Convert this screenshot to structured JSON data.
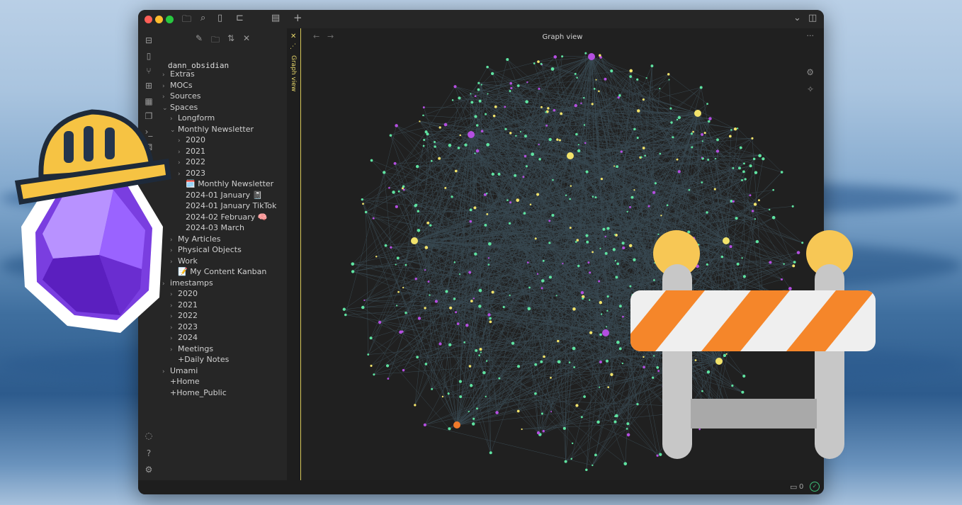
{
  "window": {
    "title": "Graph view",
    "vertical_tab_label": "Graph view",
    "vault_name": "dann_obsidian"
  },
  "tree": [
    {
      "label": "Extras",
      "indent": 0,
      "chev": true
    },
    {
      "label": "MOCs",
      "indent": 0,
      "chev": true
    },
    {
      "label": "Sources",
      "indent": 0,
      "chev": true
    },
    {
      "label": "Spaces",
      "indent": 0,
      "chev": true,
      "open": true
    },
    {
      "label": "Longform",
      "indent": 1,
      "chev": true
    },
    {
      "label": "Monthly Newsletter",
      "indent": 1,
      "chev": true,
      "open": true
    },
    {
      "label": "2020",
      "indent": 2,
      "chev": true
    },
    {
      "label": "2021",
      "indent": 2,
      "chev": true
    },
    {
      "label": "2022",
      "indent": 2,
      "chev": true
    },
    {
      "label": "2023",
      "indent": 2,
      "chev": true
    },
    {
      "label": "🗓️ Monthly Newsletter",
      "indent": 2,
      "chev": false
    },
    {
      "label": "2024-01 January 📓",
      "indent": 2,
      "chev": false
    },
    {
      "label": "2024-01 January TikTok",
      "indent": 2,
      "chev": false
    },
    {
      "label": "2024-02 February 🧠",
      "indent": 2,
      "chev": false
    },
    {
      "label": "2024-03 March",
      "indent": 2,
      "chev": false
    },
    {
      "label": "My Articles",
      "indent": 1,
      "chev": true
    },
    {
      "label": "Physical Objects",
      "indent": 1,
      "chev": true
    },
    {
      "label": "Work",
      "indent": 1,
      "chev": true
    },
    {
      "label": "📝 My Content Kanban",
      "indent": 1,
      "chev": false
    },
    {
      "label": "imestamps",
      "indent": 0,
      "chev": true
    },
    {
      "label": "2020",
      "indent": 1,
      "chev": true
    },
    {
      "label": "2021",
      "indent": 1,
      "chev": true
    },
    {
      "label": "2022",
      "indent": 1,
      "chev": true
    },
    {
      "label": "2023",
      "indent": 1,
      "chev": true
    },
    {
      "label": "2024",
      "indent": 1,
      "chev": true
    },
    {
      "label": "Meetings",
      "indent": 1,
      "chev": true
    },
    {
      "label": "+Daily Notes",
      "indent": 1,
      "chev": false
    },
    {
      "label": "Umami",
      "indent": 0,
      "chev": true
    },
    {
      "label": "+Home",
      "indent": 0,
      "chev": false
    },
    {
      "label": "+Home_Public",
      "indent": 0,
      "chev": false
    }
  ],
  "status": {
    "comment_count": "0"
  },
  "colors": {
    "node_green": "#5fe3a1",
    "node_yellow": "#f2e36b",
    "node_purple": "#b44fe0",
    "node_orange": "#f07a2a",
    "edge": "#4c6a7a",
    "accent": "#e6d66a"
  },
  "icons": {
    "ribbon": [
      "open-vault-icon",
      "file-icon",
      "git-branch-icon",
      "grid-icon",
      "calendar-icon",
      "copy-icon",
      "terminal-icon",
      "dice-icon",
      "help-icon",
      "settings-icon"
    ]
  }
}
